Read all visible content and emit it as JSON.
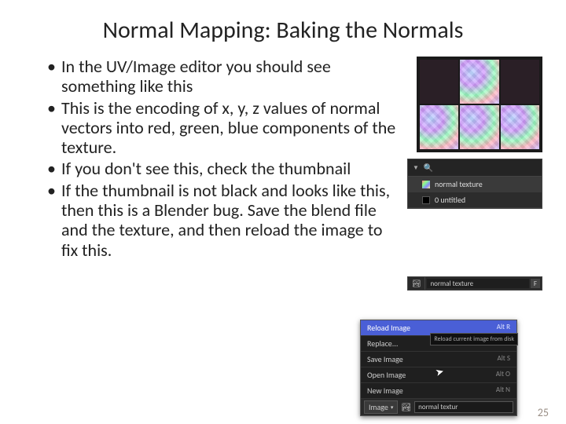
{
  "title": "Normal Mapping: Baking the Normals",
  "bullets": [
    "In the UV/Image editor you should see something like this",
    "This is the encoding of x, y, z values of normal vectors into red, green, blue components of the texture.",
    "If you don't see this, check the thumbnail",
    "If the thumbnail is not black and looks like this, then this is a Blender bug. Save the blend file and the texture, and then reload the image to fix this."
  ],
  "side_panel": {
    "items": [
      {
        "label": "normal texture"
      },
      {
        "label": "0 untitled"
      }
    ]
  },
  "image_field": {
    "icon": "🏞",
    "name": "normal texture",
    "f": "F"
  },
  "ctx": {
    "items": [
      {
        "label": "Reload Image",
        "shortcut": "Alt R",
        "hi": true
      },
      {
        "label": "Replace...",
        "shortcut": ""
      },
      {
        "label": "Save Image",
        "shortcut": "Alt S"
      },
      {
        "label": "Open Image",
        "shortcut": "Alt O"
      },
      {
        "label": "New Image",
        "shortcut": "Alt N"
      }
    ],
    "tooltip": "Reload current image from disk",
    "footer_label": "Image",
    "footer_chev": "▾",
    "footer_icon": "🏞",
    "footer_field": "normal textur"
  },
  "page_number": "25"
}
